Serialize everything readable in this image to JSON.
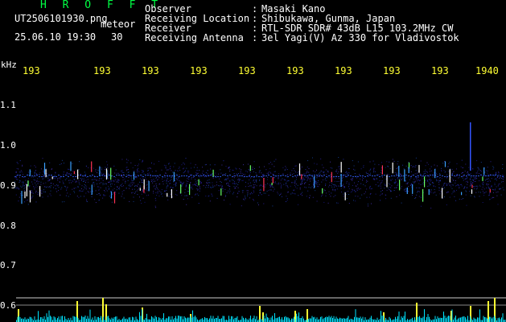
{
  "brand": "H R O F F T",
  "filename": "UT2506101930.png",
  "meteor_label": "meteor",
  "datetime": "25.06.10 19:30",
  "count_value": "30",
  "info": [
    {
      "label": "Observer",
      "value": "Masaki Kano"
    },
    {
      "label": "Receiving Location",
      "value": "Shibukawa, Gunma, Japan"
    },
    {
      "label": "Receiver",
      "value": "RTL-SDR SDR# 43dB L15 103.2MHz CW"
    },
    {
      "label": "Receiving Antenna",
      "value": "3el Yagi(V) Az 330 for Vladivostok"
    }
  ],
  "y_axis": {
    "unit": "kHz",
    "labels": [
      "1.1",
      "1.0",
      "0.9",
      "0.8",
      "0.7",
      "0.6"
    ]
  },
  "x_axis": {
    "labels": [
      "193",
      "193",
      "193",
      "193",
      "193",
      "193",
      "193",
      "193",
      "193",
      "1940"
    ]
  },
  "colors": {
    "background": "#000000",
    "brand": "#00ff44",
    "time_labels": "#ffff33",
    "counts": "#ffff33",
    "noise": "#00e5ff",
    "echo_strong": "#ff3355",
    "grid": "#cccccc"
  }
}
